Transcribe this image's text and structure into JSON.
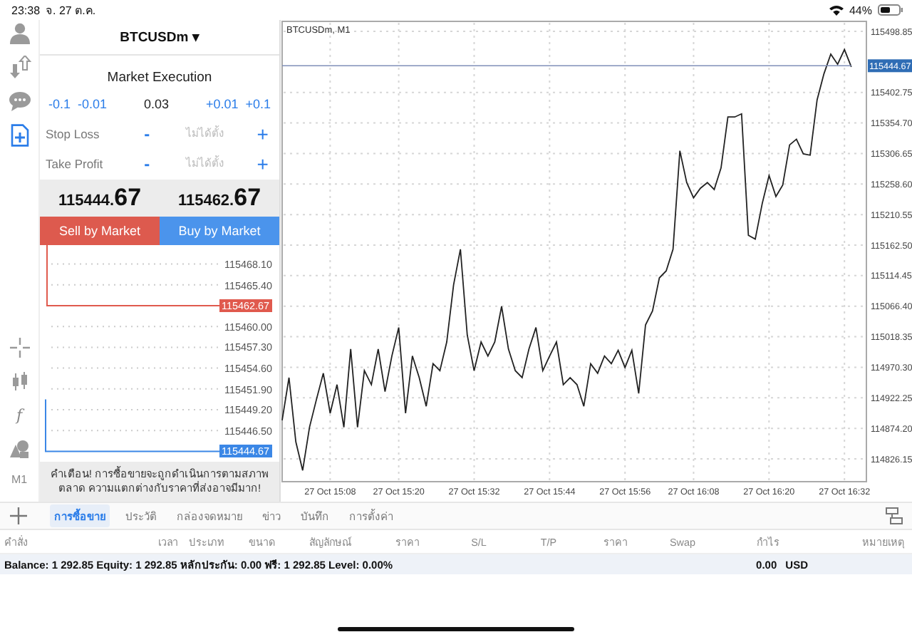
{
  "status_bar": {
    "time": "23:38",
    "date": "จ. 27 ต.ค.",
    "battery": "44%"
  },
  "rail": [
    {
      "kind": "user",
      "selected": false
    },
    {
      "kind": "transfer",
      "selected": false
    },
    {
      "kind": "chat",
      "selected": false
    },
    {
      "kind": "new-order",
      "selected": true
    }
  ],
  "rail_tools": [
    {
      "kind": "crosshair"
    },
    {
      "kind": "candles"
    },
    {
      "kind": "text",
      "label": "f"
    },
    {
      "kind": "objects"
    },
    {
      "kind": "text",
      "label": "M1"
    }
  ],
  "order": {
    "symbol": "BTCUSDm",
    "symbol_caret": "▾",
    "execution": "Market Execution",
    "volume": {
      "minus": [
        "-0.1",
        "-0.01"
      ],
      "value": "0.03",
      "plus": [
        "+0.01",
        "+0.1"
      ]
    },
    "stops": [
      {
        "label": "Stop Loss",
        "minus": "-",
        "placeholder": "ไม่ได้ตั้ง",
        "plus": "+"
      },
      {
        "label": "Take Profit",
        "minus": "-",
        "placeholder": "ไม่ได้ตั้ง",
        "plus": "+"
      }
    ],
    "bid": {
      "main": "115444.",
      "pips": "67"
    },
    "ask": {
      "main": "115462.",
      "pips": "67"
    },
    "sell_button": "Sell by Market",
    "buy_button": "Buy by Market",
    "depth": [
      {
        "kind": "level",
        "label": "115468.10"
      },
      {
        "kind": "level",
        "label": "115465.40"
      },
      {
        "kind": "ask",
        "label": "115462.67"
      },
      {
        "kind": "level",
        "label": "115460.00"
      },
      {
        "kind": "level",
        "label": "115457.30"
      },
      {
        "kind": "level",
        "label": "115454.60"
      },
      {
        "kind": "level",
        "label": "115451.90"
      },
      {
        "kind": "level",
        "label": "115449.20"
      },
      {
        "kind": "level",
        "label": "115446.50"
      },
      {
        "kind": "bid",
        "label": "115444.67"
      }
    ],
    "warning": "คำเตือน! การซื้อขายจะถูกดำเนินการตามสภาพตลาด ความแตกต่างกับราคาที่ส่งอาจมีมาก!"
  },
  "chart": {
    "title": "BTCUSDm, M1",
    "chart_data": {
      "type": "line",
      "categories": [
        null,
        null,
        null,
        null,
        null,
        null,
        null,
        "27 Oct 15:08",
        null,
        null,
        null,
        null,
        null,
        null,
        null,
        null,
        null,
        "27 Oct 15:20",
        null,
        null,
        null,
        null,
        null,
        null,
        null,
        null,
        null,
        null,
        "27 Oct 15:32",
        null,
        null,
        null,
        null,
        null,
        null,
        null,
        null,
        null,
        null,
        "27 Oct 15:44",
        null,
        null,
        null,
        null,
        null,
        null,
        null,
        null,
        null,
        null,
        "27 Oct 15:56",
        null,
        null,
        null,
        null,
        null,
        null,
        null,
        null,
        null,
        "27 Oct 16:08",
        null,
        null,
        null,
        null,
        null,
        null,
        null,
        null,
        null,
        null,
        "27 Oct 16:20",
        null,
        null,
        null,
        null,
        null,
        null,
        null,
        null,
        null,
        null,
        "27 Oct 16:32",
        null
      ],
      "series": [
        {
          "color": "#222222",
          "values": [
            114887,
            114954,
            114853,
            114808,
            114876,
            114920,
            114961,
            114898,
            114943,
            114876,
            114999,
            114876,
            114965,
            114943,
            114999,
            114932,
            114988,
            115033,
            114898,
            114988,
            114954,
            114909,
            114976,
            114965,
            115010,
            115100,
            115156,
            115021,
            114965,
            115010,
            114988,
            115010,
            115066,
            114999,
            114965,
            114954,
            114999,
            115033,
            114965,
            114988,
            115010,
            114943,
            114954,
            114943,
            114909,
            114976,
            114961,
            114988,
            114976,
            114997,
            114970,
            114997,
            114929,
            115037,
            115059,
            115111,
            115122,
            115156,
            115311,
            115261,
            115237,
            115252,
            115261,
            115250,
            115284,
            115364,
            115364,
            115369,
            115178,
            115172,
            115228,
            115272,
            115239,
            115257,
            115320,
            115329,
            115306,
            115304,
            115391,
            115432,
            115463,
            115447,
            115470,
            115443
          ]
        },
        {
          "color": "#8090b8",
          "values": [
            115444.67,
            115444.67,
            115444.67,
            115444.67,
            115444.67,
            115444.67,
            115444.67,
            115444.67,
            115444.67,
            115444.67,
            115444.67,
            115444.67,
            115444.67,
            115444.67,
            115444.67,
            115444.67,
            115444.67,
            115444.67,
            115444.67,
            115444.67,
            115444.67,
            115444.67,
            115444.67,
            115444.67,
            115444.67,
            115444.67,
            115444.67,
            115444.67,
            115444.67,
            115444.67,
            115444.67,
            115444.67,
            115444.67,
            115444.67,
            115444.67,
            115444.67,
            115444.67,
            115444.67,
            115444.67,
            115444.67,
            115444.67,
            115444.67,
            115444.67,
            115444.67,
            115444.67,
            115444.67,
            115444.67,
            115444.67,
            115444.67,
            115444.67,
            115444.67,
            115444.67,
            115444.67,
            115444.67,
            115444.67,
            115444.67,
            115444.67,
            115444.67,
            115444.67,
            115444.67,
            115444.67,
            115444.67,
            115444.67,
            115444.67,
            115444.67,
            115444.67,
            115444.67,
            115444.67,
            115444.67,
            115444.67,
            115444.67,
            115444.67,
            115444.67,
            115444.67,
            115444.67,
            115444.67,
            115444.67,
            115444.67,
            115444.67,
            115444.67,
            115444.67,
            115444.67,
            115444.67,
            115444.67
          ]
        }
      ],
      "ylim": [
        114790.3,
        115514.5
      ],
      "grid": true,
      "yticks": [
        {
          "value": 115498.85,
          "label": "115498.85"
        },
        {
          "value": 115402.75,
          "label": "115402.75"
        },
        {
          "value": 115354.7,
          "label": "115354.70"
        },
        {
          "value": 115306.65,
          "label": "115306.65"
        },
        {
          "value": 115258.6,
          "label": "115258.60"
        },
        {
          "value": 115210.55,
          "label": "115210.55"
        },
        {
          "value": 115162.5,
          "label": "115162.50"
        },
        {
          "value": 115114.45,
          "label": "115114.45"
        },
        {
          "value": 115066.4,
          "label": "115066.40"
        },
        {
          "value": 115018.35,
          "label": "115018.35"
        },
        {
          "value": 114970.3,
          "label": "114970.30"
        },
        {
          "value": 114922.25,
          "label": "114922.25"
        },
        {
          "value": 114874.2,
          "label": "114874.20"
        },
        {
          "value": 114826.15,
          "label": "114826.15"
        }
      ],
      "title": null
    },
    "current_price": "115444.67"
  },
  "tabs": [
    {
      "label": "การซื้อขาย",
      "selected": true
    },
    {
      "label": "ประวัติ",
      "selected": false
    },
    {
      "label": "กล่องจดหมาย",
      "selected": false
    },
    {
      "label": "ข่าว",
      "selected": false
    },
    {
      "label": "บันทึก",
      "selected": false
    },
    {
      "label": "การตั้งค่า",
      "selected": false
    }
  ],
  "table": {
    "columns": [
      "คำสั่ง",
      "เวลา",
      "ประเภท",
      "ขนาด",
      "สัญลักษณ์",
      "ราคา",
      "S/L",
      "T/P",
      "ราคา",
      "Swap",
      "กำไร",
      "หมายเหตุ"
    ],
    "summary": {
      "text": "Balance: 1 292.85 Equity: 1 292.85 หลักประกัน: 0.00 ฟรี: 1 292.85 Level: 0.00%",
      "profit": "0.00",
      "currency": "USD"
    }
  }
}
